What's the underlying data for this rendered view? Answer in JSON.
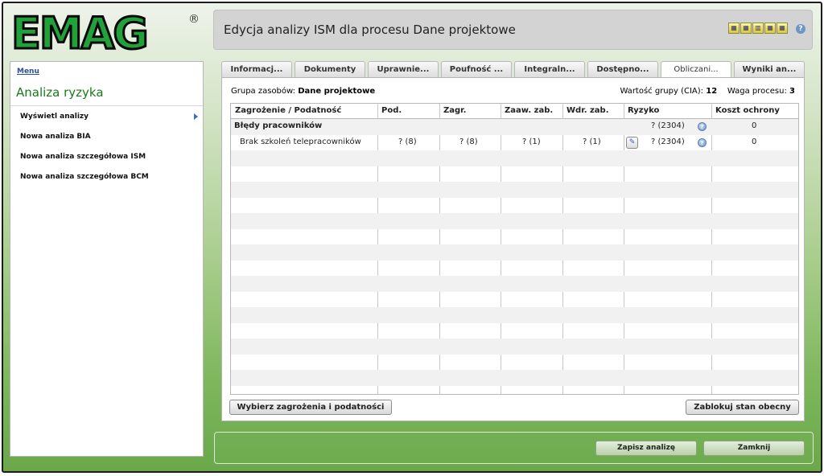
{
  "logo": {
    "text": "EMAG",
    "mark": "®"
  },
  "header": {
    "title": "Edycja analizy ISM dla procesu Dane projektowe",
    "icons": [
      "tool-icon-1",
      "tool-icon-2",
      "tool-icon-3",
      "tool-icon-4",
      "tool-icon-5"
    ],
    "help_icon": "?"
  },
  "sidebar": {
    "menu_label": "Menu",
    "title": "Analiza ryzyka",
    "items": [
      {
        "label": "Wyświetl analizy"
      },
      {
        "label": "Nowa analiza BIA"
      },
      {
        "label": "Nowa analiza szczegółowa ISM"
      },
      {
        "label": "Nowa analiza szczegółowa BCM"
      }
    ]
  },
  "tabs": [
    {
      "label": "Informacj..."
    },
    {
      "label": "Dokumenty"
    },
    {
      "label": "Uprawnie..."
    },
    {
      "label": "Poufność ..."
    },
    {
      "label": "Integraln..."
    },
    {
      "label": "Dostępno..."
    },
    {
      "label": "Obliczani..."
    },
    {
      "label": "Wyniki an..."
    }
  ],
  "info": {
    "group_label": "Grupa zasobów:",
    "group_value": "Dane projektowe",
    "cia_label": "Wartość grupy (CIA):",
    "cia_value": "12",
    "weight_label": "Waga procesu:",
    "weight_value": "3"
  },
  "table": {
    "headers": [
      "Zagrożenie / Podatność",
      "Pod.",
      "Zagr.",
      "Zaaw. zab.",
      "Wdr. zab.",
      "Ryzyko",
      "Koszt ochrony"
    ],
    "rows": [
      {
        "name": "Błędy pracowników",
        "pod": "",
        "zagr": "",
        "zaaw": "",
        "wdr": "",
        "ryzyko": "? (2304)",
        "koszt": "0"
      },
      {
        "name": "Brak szkoleń telepracowników",
        "pod": "? (8)",
        "zagr": "? (8)",
        "zaaw": "? (1)",
        "wdr": "? (1)",
        "ryzyko": "? (2304)",
        "koszt": "0"
      }
    ]
  },
  "buttons": {
    "choose": "Wybierz zagrożenia i podatności",
    "lock": "Zablokuj stan obecny",
    "save": "Zapisz analizę",
    "close": "Zamknij"
  }
}
